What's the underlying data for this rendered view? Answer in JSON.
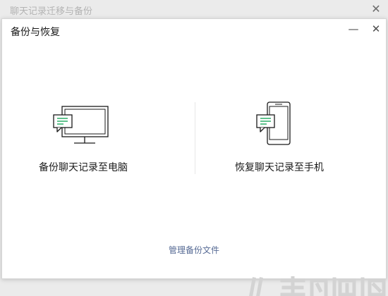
{
  "background_window": {
    "title": "聊天记录迁移与备份",
    "close_glyph": "✕"
  },
  "dialog": {
    "title": "备份与恢复",
    "minimize_glyph": "—",
    "close_glyph": "✕",
    "options": [
      {
        "label": "备份聊天记录至电脑",
        "icon": "monitor-chat-icon"
      },
      {
        "label": "恢复聊天记录至手机",
        "icon": "phone-chat-icon"
      }
    ],
    "manage_link": "管理备份文件"
  },
  "colors": {
    "link": "#576b95",
    "chat_lines": "#2aae67",
    "icon_stroke": "#1a1a1a"
  }
}
